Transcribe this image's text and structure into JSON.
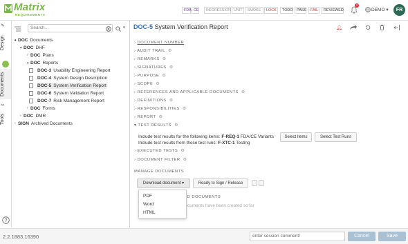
{
  "app": {
    "logo_text": "Matrix",
    "logo_sub": "REQUIREMENTS"
  },
  "header": {
    "filters": [
      {
        "label": "FDA",
        "color": "#6a3aa0"
      },
      {
        "label": "CE",
        "color": "#6a3aa0"
      },
      {
        "label": "REGRESSION",
        "color": "#999999"
      },
      {
        "label": "UNIT",
        "color": "#999999"
      },
      {
        "label": "SMOKE",
        "color": "#999999"
      },
      {
        "label": "LOCK",
        "color": "#d0302b"
      },
      {
        "label": "TODO",
        "color": "#333333"
      },
      {
        "label": "PASS",
        "color": "#333333"
      },
      {
        "label": "FAIL",
        "color": "#d0302b"
      },
      {
        "label": "REVIEWED",
        "color": "#333333"
      }
    ],
    "notification_count": "2",
    "project": "DEMO",
    "user_initials": "FR"
  },
  "rail": {
    "tabs": [
      "Design",
      "Documents",
      "Tools"
    ],
    "help_icon": "help-icon"
  },
  "tree": {
    "search_placeholder": "Search...",
    "nodes": [
      {
        "key": "DOC",
        "label": "Documents"
      },
      {
        "key": "DOC",
        "label": "DHF"
      },
      {
        "key": "DOC",
        "label": "Plans"
      },
      {
        "key": "DOC",
        "label": "Reports"
      },
      {
        "key": "DOC-3",
        "label": "Usability Engineering Report"
      },
      {
        "key": "DOC-4",
        "label": "System Design Description"
      },
      {
        "key": "DOC-5",
        "label": "System Verification Report"
      },
      {
        "key": "DOC-6",
        "label": "System Validation Report"
      },
      {
        "key": "DOC-7",
        "label": "Risk Management Report"
      },
      {
        "key": "DOC",
        "label": "Forms"
      },
      {
        "key": "DOC",
        "label": "DMR"
      },
      {
        "key": "SIGN",
        "label": "Archived Documents"
      }
    ]
  },
  "document": {
    "id": "DOC-5",
    "title": "System Verification Report",
    "sections": [
      "DOCUMENT NUMBER",
      "AUDIT TRAIL",
      "REMARKS",
      "SIGNATURES",
      "PURPOSE",
      "SCOPE",
      "REFERENCES AND APPLICABLE DOCUMENTS",
      "DEFINITIONS",
      "RESPONSIBILITIES",
      "REPORT",
      "TEST RESULTS",
      "EXECUTED TESTS",
      "DOCUMENT FILTER"
    ],
    "test_results": {
      "line1_pre": "Include test results for the following items:",
      "line1_bold": "F-REQ-1",
      "line1_post": "FDA/CE Variants",
      "line2_pre": "Include test results from these test runs:",
      "line2_bold": "F-XTC-1",
      "line2_post": "Testing",
      "select_items": "Select Items",
      "select_runs": "Select Test Runs"
    },
    "manage": {
      "heading": "MANAGE DOCUMENTS",
      "download": "Download document",
      "ready": "Ready to Sign / Release",
      "signed_heading": "SIGNED DOCUMENTS",
      "signed_text": "documents have been created so far",
      "options": [
        "PDF",
        "Word",
        "HTML"
      ]
    }
  },
  "footer": {
    "version": "2.2.1883.16390",
    "comment_placeholder": "enter session comment!",
    "cancel": "Cancel",
    "save": "Save"
  }
}
